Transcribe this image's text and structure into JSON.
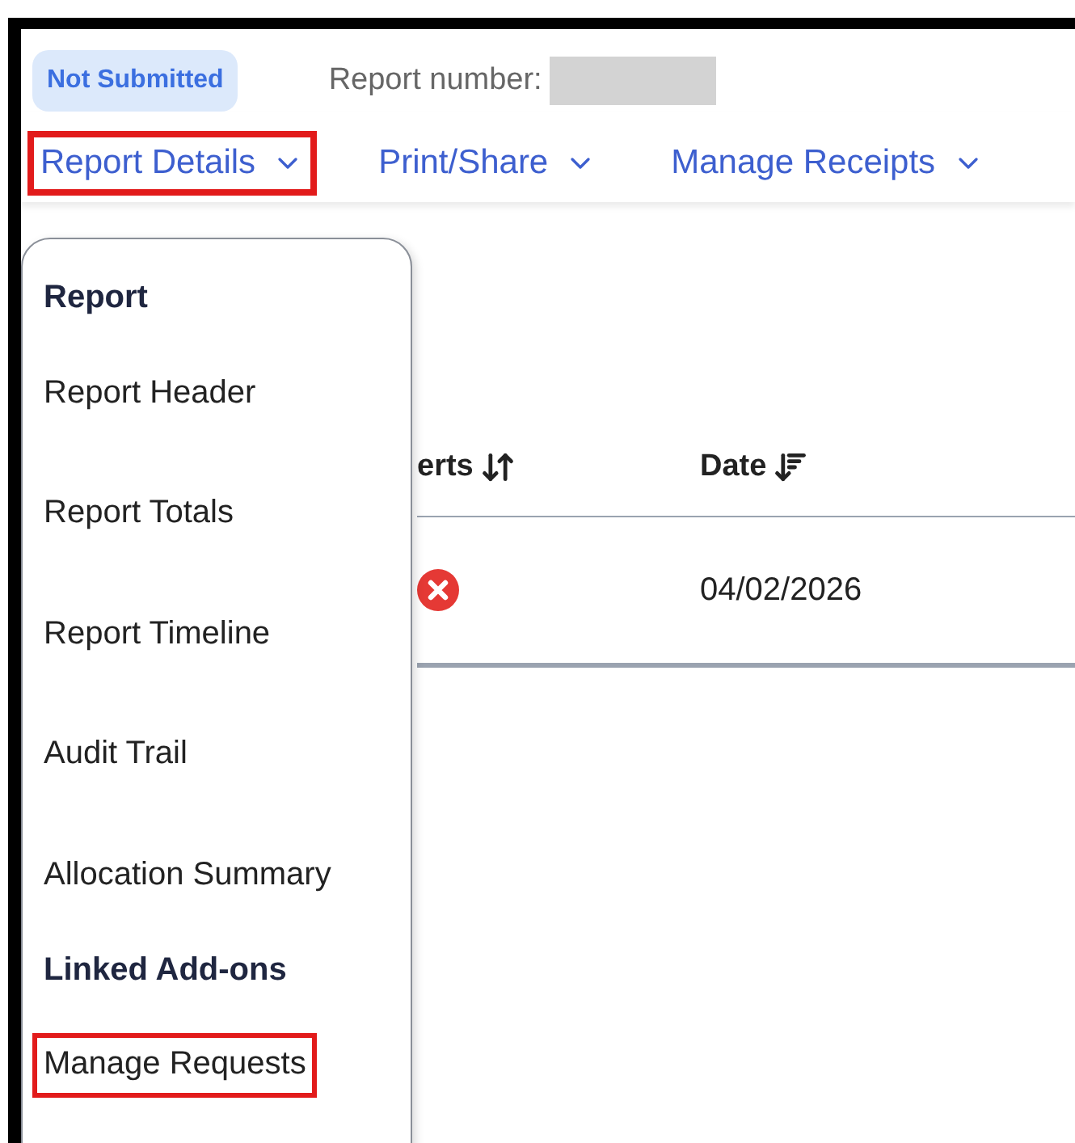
{
  "status_badge": "Not Submitted",
  "report_number_label": "Report number:",
  "nav": [
    {
      "label": "Report Details",
      "highlighted": true
    },
    {
      "label": "Print/Share",
      "highlighted": false
    },
    {
      "label": "Manage Receipts",
      "highlighted": false
    }
  ],
  "table": {
    "columns": [
      {
        "label": "erts",
        "kind": "sortable"
      },
      {
        "label": "Date",
        "kind": "sorted"
      }
    ],
    "rows": [
      {
        "kind": "error",
        "date": "04/02/2026"
      }
    ]
  },
  "menu": [
    {
      "kind": "heading",
      "label": "Report"
    },
    {
      "kind": "item",
      "label": "Report Header",
      "highlighted": false
    },
    {
      "kind": "item",
      "label": "Report Totals",
      "highlighted": false
    },
    {
      "kind": "item",
      "label": "Report Timeline",
      "highlighted": false
    },
    {
      "kind": "item",
      "label": "Audit Trail",
      "highlighted": false
    },
    {
      "kind": "item",
      "label": "Allocation Summary",
      "highlighted": false
    },
    {
      "kind": "heading",
      "label": "Linked Add-ons"
    },
    {
      "kind": "item",
      "label": "Manage Requests",
      "highlighted": true
    }
  ]
}
